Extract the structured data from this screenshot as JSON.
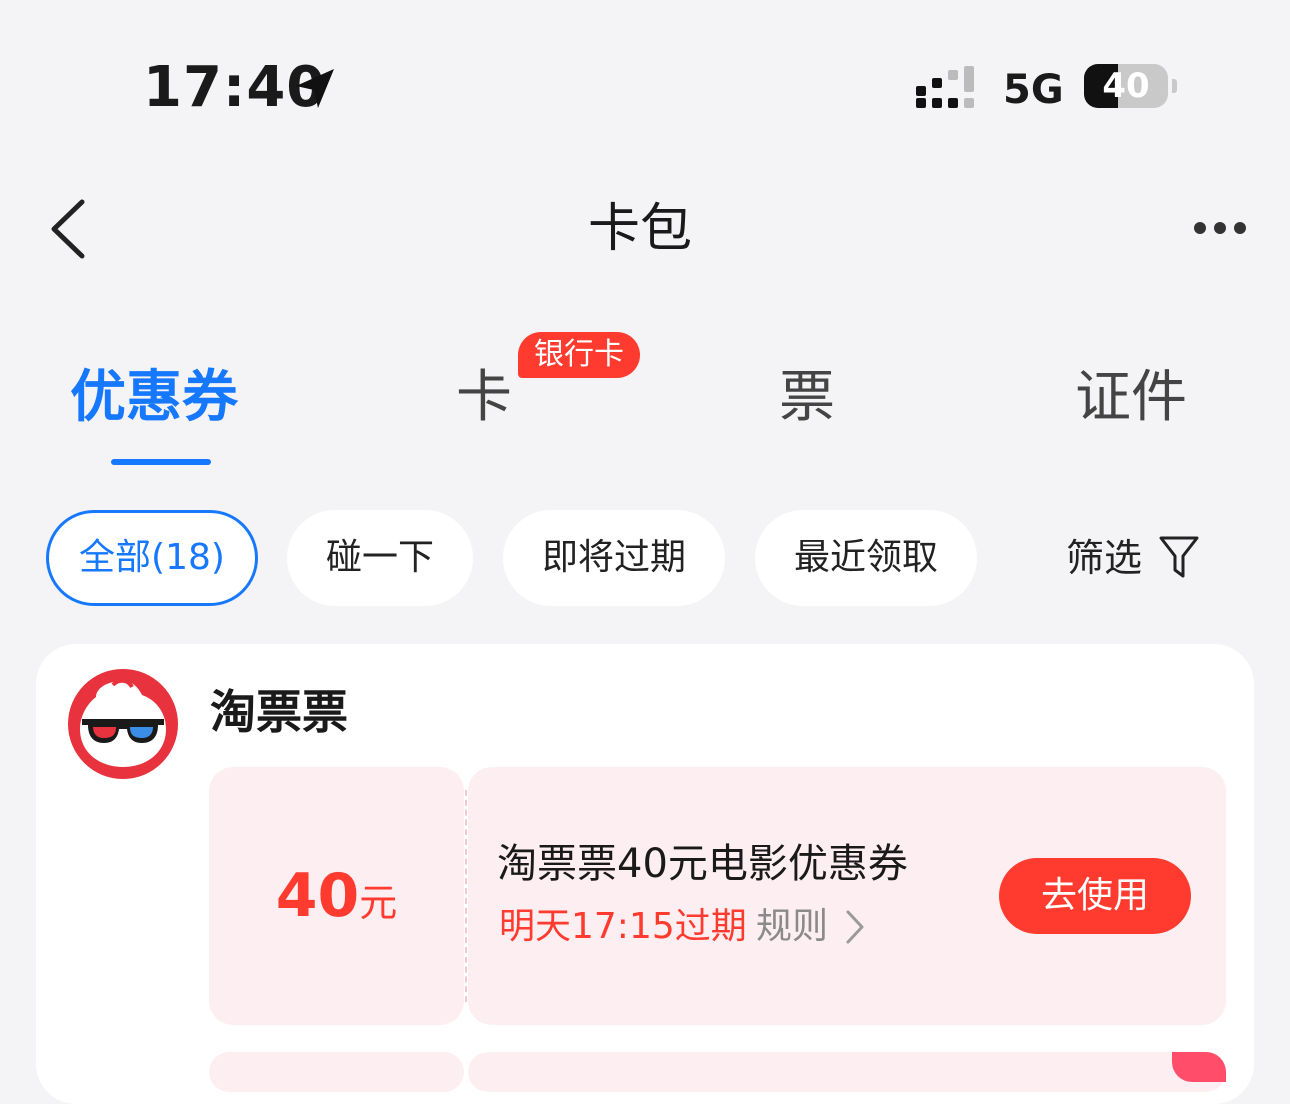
{
  "status_bar": {
    "time": "17:40",
    "network": "5G",
    "battery": "40",
    "battery_level": 0.4
  },
  "nav": {
    "title": "卡包"
  },
  "tabs": [
    {
      "label": "优惠券",
      "active": true
    },
    {
      "label": "卡",
      "badge": "银行卡"
    },
    {
      "label": "票"
    },
    {
      "label": "证件"
    }
  ],
  "filters": {
    "chips": [
      "全部(18)",
      "碰一下",
      "即将过期",
      "最近领取"
    ],
    "filter_label": "筛选"
  },
  "coupons": [
    {
      "brand": "淘票票",
      "amount": "40",
      "unit": "元",
      "title": "淘票票40元电影优惠券",
      "expiry": "明天17:15过期",
      "rules": "规则",
      "action": "去使用"
    }
  ],
  "colors": {
    "accent": "#1677ff",
    "red": "#ff3b2f",
    "coupon_bg": "#fdeff1"
  }
}
